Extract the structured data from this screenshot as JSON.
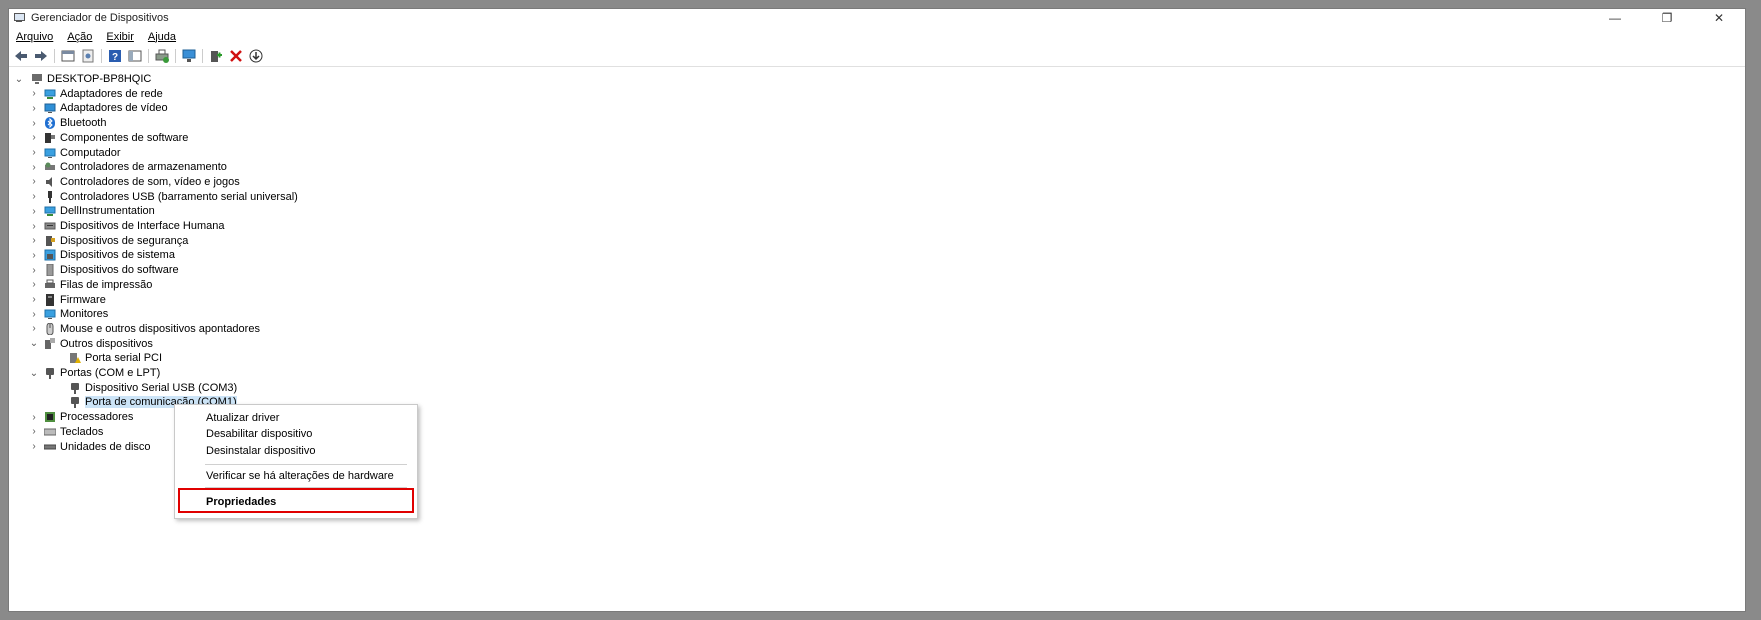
{
  "window": {
    "title": "Gerenciador de Dispositivos",
    "controls": [
      "—",
      "❐",
      "✕"
    ]
  },
  "menu": [
    "Arquivo",
    "Ação",
    "Exibir",
    "Ajuda"
  ],
  "toolbar_icons": [
    "back-arrow-icon",
    "forward-arrow-icon",
    "properties-sheet-icon",
    "update-driver-icon",
    "help-icon",
    "show-hide-console-tree-icon",
    "print-icon",
    "scan-hardware-icon",
    "add-driver-icon",
    "uninstall-x-icon",
    "download-icon"
  ],
  "tree": {
    "root": "DESKTOP-BP8HQIC",
    "items": [
      {
        "label": "Adaptadores de rede",
        "icon": "network-adapter-icon"
      },
      {
        "label": "Adaptadores de vídeo",
        "icon": "display-adapter-icon"
      },
      {
        "label": "Bluetooth",
        "icon": "bluetooth-icon"
      },
      {
        "label": "Componentes de software",
        "icon": "software-component-icon"
      },
      {
        "label": "Computador",
        "icon": "computer-icon"
      },
      {
        "label": "Controladores de armazenamento",
        "icon": "storage-controller-icon"
      },
      {
        "label": "Controladores de som, vídeo e jogos",
        "icon": "speaker-icon"
      },
      {
        "label": "Controladores USB (barramento serial universal)",
        "icon": "usb-icon"
      },
      {
        "label": "DellInstrumentation",
        "icon": "dell-instrumentation-icon"
      },
      {
        "label": "Dispositivos de Interface Humana",
        "icon": "hid-icon"
      },
      {
        "label": "Dispositivos de segurança",
        "icon": "security-key-icon"
      },
      {
        "label": "Dispositivos de sistema",
        "icon": "system-device-icon"
      },
      {
        "label": "Dispositivos do software",
        "icon": "software-device-icon"
      },
      {
        "label": "Filas de impressão",
        "icon": "printer-icon"
      },
      {
        "label": "Firmware",
        "icon": "firmware-icon"
      },
      {
        "label": "Monitores",
        "icon": "monitor-icon"
      },
      {
        "label": "Mouse e outros dispositivos apontadores",
        "icon": "mouse-icon"
      },
      {
        "label": "Outros dispositivos",
        "icon": "other-devices-icon",
        "expanded": true
      },
      {
        "label": "Porta serial PCI",
        "icon": "warning-device-icon",
        "child": true
      },
      {
        "label": "Portas (COM e LPT)",
        "icon": "port-icon",
        "expanded": true
      },
      {
        "label": "Dispositivo Serial USB (COM3)",
        "icon": "port-icon",
        "child": true
      },
      {
        "label": "Porta de comunicação (COM1)",
        "icon": "port-icon",
        "child": true,
        "selected": true
      },
      {
        "label": "Processadores",
        "icon": "processor-icon"
      },
      {
        "label": "Teclados",
        "icon": "keyboard-icon"
      },
      {
        "label": "Unidades de disco",
        "icon": "disk-drive-icon"
      }
    ]
  },
  "context_menu": {
    "items": [
      "Atualizar driver",
      "Desabilitar dispositivo",
      "Desinstalar dispositivo",
      "Verificar se há alterações de hardware",
      "Propriedades"
    ],
    "highlight_color": "#e00000"
  }
}
